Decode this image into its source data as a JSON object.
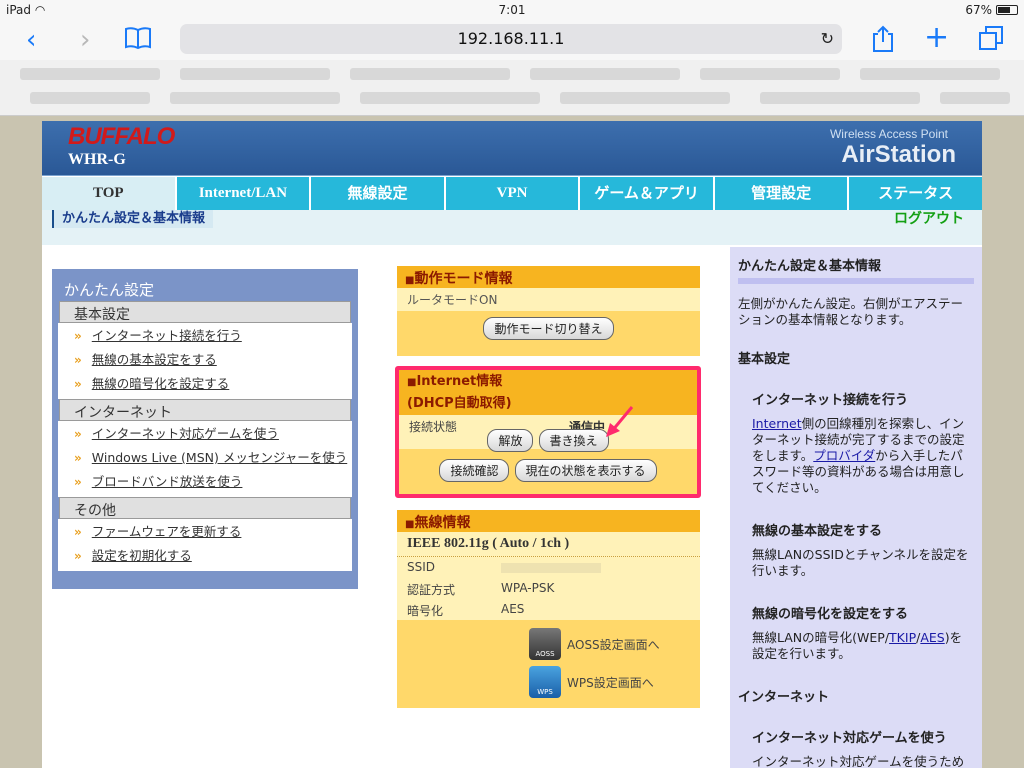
{
  "status": {
    "device": "iPad",
    "time": "7:01",
    "battery": "67%"
  },
  "browser": {
    "url": "192.168.11.1"
  },
  "brand": {
    "logo": "BUFFALO",
    "model": "WHR-G",
    "tagline": "Wireless Access Point",
    "product": "AirStation"
  },
  "nav": {
    "tabs": [
      "TOP",
      "Internet/LAN",
      "無線設定",
      "VPN",
      "ゲーム＆アプリ",
      "管理設定",
      "ステータス"
    ]
  },
  "subbar": {
    "current": "かんたん設定＆基本情報",
    "logout": "ログアウト"
  },
  "left": {
    "title": "かんたん設定",
    "sections": [
      {
        "name": "基本設定",
        "items": [
          "インターネット接続を行う",
          "無線の基本設定をする",
          "無線の暗号化を設定する"
        ]
      },
      {
        "name": "インターネット",
        "items": [
          "インターネット対応ゲームを使う",
          "Windows Live (MSN) メッセンジャーを使う",
          "ブロードバンド放送を使う"
        ]
      },
      {
        "name": "その他",
        "items": [
          "ファームウェアを更新する",
          "設定を初期化する"
        ]
      }
    ]
  },
  "mode": {
    "title": "動作モード情報",
    "status": "ルータモードON",
    "button": "動作モード切り替え"
  },
  "internet": {
    "title": "Internet情報",
    "method": "(DHCP自動取得)",
    "conn_label": "接続状態",
    "conn_value": "通信中",
    "release": "解放",
    "rewrite": "書き換え",
    "check": "接続確認",
    "show": "現在の状態を表示する"
  },
  "wireless": {
    "title": "無線情報",
    "standard": "IEEE 802.11g ( Auto / 1ch )",
    "ssid_label": "SSID",
    "auth_label": "認証方式",
    "auth_value": "WPA-PSK",
    "enc_label": "暗号化",
    "enc_value": "AES",
    "aoss": "AOSS設定画面へ",
    "wps": "WPS設定画面へ",
    "aoss_icon": "AOSS",
    "wps_icon": "WPS"
  },
  "help": {
    "title": "かんたん設定＆基本情報",
    "intro": "左側がかんたん設定。右側がエアステーションの基本情報となります。",
    "sec1": "基本設定",
    "h1": "インターネット接続を行う",
    "t1a": "Internet",
    "t1b": "側の回線種別を探索し、インターネット接続が完了するまでの設定をします。",
    "t1c": "プロバイダ",
    "t1d": "から入手したパスワード等の資料がある場合は用意してください。",
    "h2": "無線の基本設定をする",
    "t2": "無線LANのSSIDとチャンネルを設定を行います。",
    "h3": "無線の暗号化を設定をする",
    "t3a": "無線LANの暗号化(WEP/",
    "t3b": "TKIP",
    "t3c": "/",
    "t3d": "AES",
    "t3e": ")を設定を行います。",
    "sec2": "インターネット",
    "h4": "インターネット対応ゲームを使う",
    "t4": "インターネット対応ゲームを使うため"
  },
  "colors": {
    "nav": "#26b8da",
    "highlight": "#ff2a6d",
    "panel_head": "#f7b420"
  }
}
